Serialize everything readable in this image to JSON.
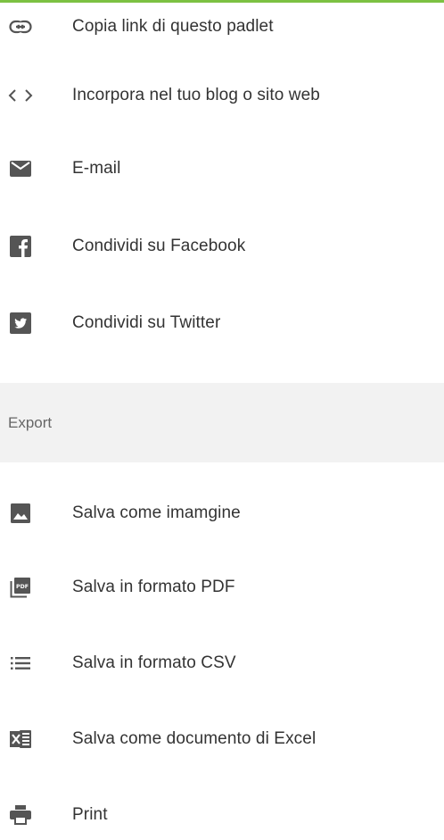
{
  "share": {
    "items": [
      {
        "label": "Copia link di questo padlet",
        "icon": "link-icon"
      },
      {
        "label": "Incorpora nel tuo blog o sito web",
        "icon": "code-icon"
      },
      {
        "label": "E-mail",
        "icon": "mail-icon"
      },
      {
        "label": "Condividi su Facebook",
        "icon": "facebook-icon"
      },
      {
        "label": "Condividi su Twitter",
        "icon": "twitter-icon"
      }
    ]
  },
  "export": {
    "title": "Export",
    "items": [
      {
        "label": "Salva come imamgine",
        "icon": "image-icon"
      },
      {
        "label": "Salva in formato PDF",
        "icon": "pdf-icon"
      },
      {
        "label": "Salva in formato CSV",
        "icon": "list-icon"
      },
      {
        "label": "Salva come documento di Excel",
        "icon": "excel-icon"
      },
      {
        "label": "Print",
        "icon": "print-icon"
      }
    ]
  },
  "colors": {
    "accent": "#7cc142",
    "icon": "#555555",
    "section_bg": "#f2f2f2"
  }
}
